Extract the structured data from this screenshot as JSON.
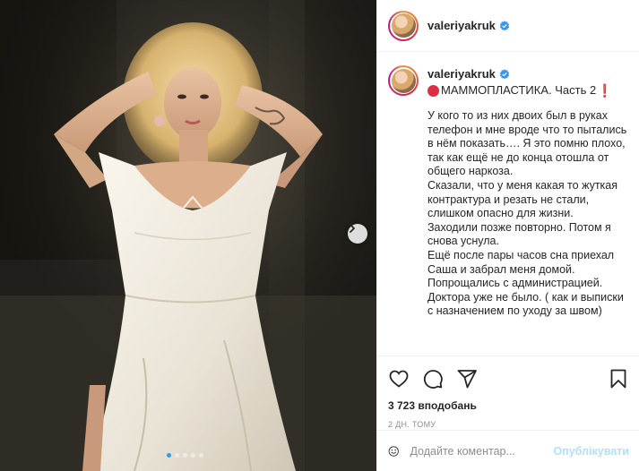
{
  "post": {
    "image_alt": "photo",
    "carousel": {
      "total": 5,
      "active": 0
    },
    "next_icon": "chevron-right-icon"
  },
  "author": {
    "username": "valeriyakruk",
    "verified_icon": "verified-badge-icon"
  },
  "caption": {
    "username": "valeriyakruk",
    "title": "МАММОПЛАСТИКА. Часть 2",
    "title_prefix_icon": "red-circle-icon",
    "title_suffix": "❗",
    "text": "У кого то из них двоих был в руках телефон и мне вроде что то пытались в нём показать…. Я это помню плохо, так как ещё не до конца отошла от общего наркоза.\nСказали, что у меня какая то жуткая контрактура и резать не стали, слишком опасно для жизни.\nЗаходили позже повторно. Потом я снова уснула.\nЕщё после пары часов сна приехал Саша и забрал меня домой.\nПопрощались с администрацией.\nДоктора уже не было. ( как и выписки с назначением по уходу за швом)"
  },
  "actions": {
    "like_icon": "heart-icon",
    "comment_icon": "comment-icon",
    "share_icon": "paper-plane-icon",
    "save_icon": "bookmark-icon"
  },
  "likes_text": "3 723 вподобань",
  "timestamp": "2 дн. тому",
  "comment_box": {
    "emoji_icon": "emoji-icon",
    "placeholder": "Додайте коментар...",
    "publish_label": "Опублікувати"
  },
  "colors": {
    "accent_blue": "#3897f0",
    "publish_disabled": "#b2dffc",
    "verified": "#3897f0",
    "alert_red": "#dd2e44"
  }
}
